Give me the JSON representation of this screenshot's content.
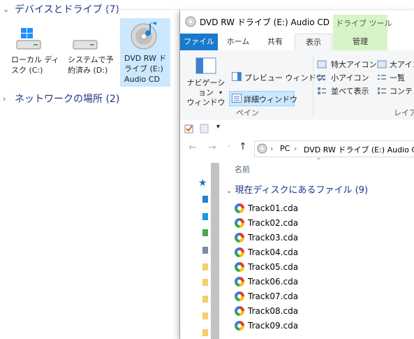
{
  "background": {
    "devices_header": "デバイスとドライブ (7)",
    "network_header": "ネットワークの場所 (2)",
    "drives": [
      {
        "label": "ローカル ディ\nスク (C:)",
        "icon": "windows-drive-icon"
      },
      {
        "label": "システムで予\n約済み (D:)",
        "icon": "hard-drive-icon"
      },
      {
        "label": "DVD RW ド\nライブ (E:)\nAudio CD",
        "icon": "cd-music-icon"
      }
    ]
  },
  "window": {
    "title": "DVD RW ドライブ (E:) Audio CD",
    "context_tab": "ドライブ ツール",
    "tabs": {
      "file": "ファイル",
      "home": "ホーム",
      "share": "共有",
      "view": "表示",
      "manage": "管理"
    },
    "ribbon": {
      "nav_pane": "ナビゲーション\nウィンドウ",
      "preview_pane": "プレビュー ウィンドウ",
      "details_pane": "詳細ウィンドウ",
      "pane_group": "ペイン",
      "extra_large_icons": "特大アイコン",
      "large_icons": "大アイコ",
      "small_icons": "小アイコン",
      "list": "一覧",
      "tiles": "並べて表示",
      "content": "コンテン",
      "layout_group": "レイア"
    },
    "address": {
      "pc": "PC",
      "drive": "DVD RW ドライブ (E:) Audio CD"
    },
    "column_name": "名前",
    "group_header": "現在ディスクにあるファイル (9)",
    "files": [
      "Track01.cda",
      "Track02.cda",
      "Track03.cda",
      "Track04.cda",
      "Track05.cda",
      "Track06.cda",
      "Track07.cda",
      "Track08.cda",
      "Track09.cda"
    ]
  },
  "colors": {
    "accent": "#1979ca",
    "selected": "#cce8ff",
    "context_tab": "#d7f4c6",
    "group_text": "#1e3287"
  }
}
